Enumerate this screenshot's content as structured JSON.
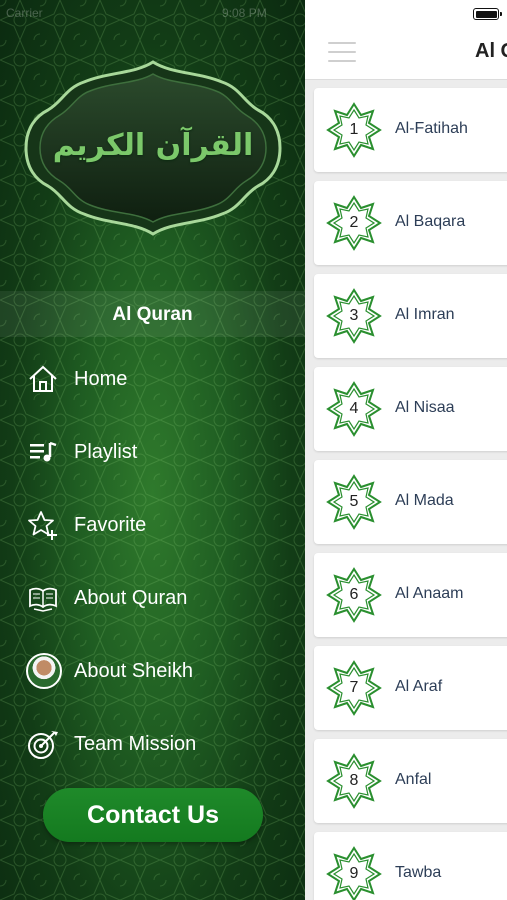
{
  "status_bar": {
    "carrier": "Carrier",
    "time": "9:08 PM",
    "battery_icon": "battery-icon"
  },
  "drawer": {
    "logo_arabic": "القرآن الكريم",
    "app_name": "Al Quran",
    "menu": [
      {
        "label": "Home",
        "icon": "home-icon"
      },
      {
        "label": "Playlist",
        "icon": "playlist-icon"
      },
      {
        "label": "Favorite",
        "icon": "star-add-icon"
      },
      {
        "label": "About Quran",
        "icon": "open-book-icon"
      },
      {
        "label": "About Sheikh",
        "icon": "avatar"
      },
      {
        "label": "Team Mission",
        "icon": "target-dart-icon"
      }
    ],
    "contact_label": "Contact Us"
  },
  "main": {
    "title": "Al Q",
    "menu_icon": "hamburger-icon",
    "surahs": [
      {
        "number": "1",
        "name": "Al-Fatihah"
      },
      {
        "number": "2",
        "name": "Al Baqara"
      },
      {
        "number": "3",
        "name": "Al Imran"
      },
      {
        "number": "4",
        "name": "Al Nisaa"
      },
      {
        "number": "5",
        "name": "Al Mada"
      },
      {
        "number": "6",
        "name": "Al Anaam"
      },
      {
        "number": "7",
        "name": "Al Araf"
      },
      {
        "number": "8",
        "name": "Anfal"
      },
      {
        "number": "9",
        "name": "Tawba"
      }
    ]
  },
  "colors": {
    "drawer_green": "#1f5d22",
    "button_green": "#1b8426",
    "star_green": "#2a8f2f",
    "surah_text": "#2d3e57"
  }
}
